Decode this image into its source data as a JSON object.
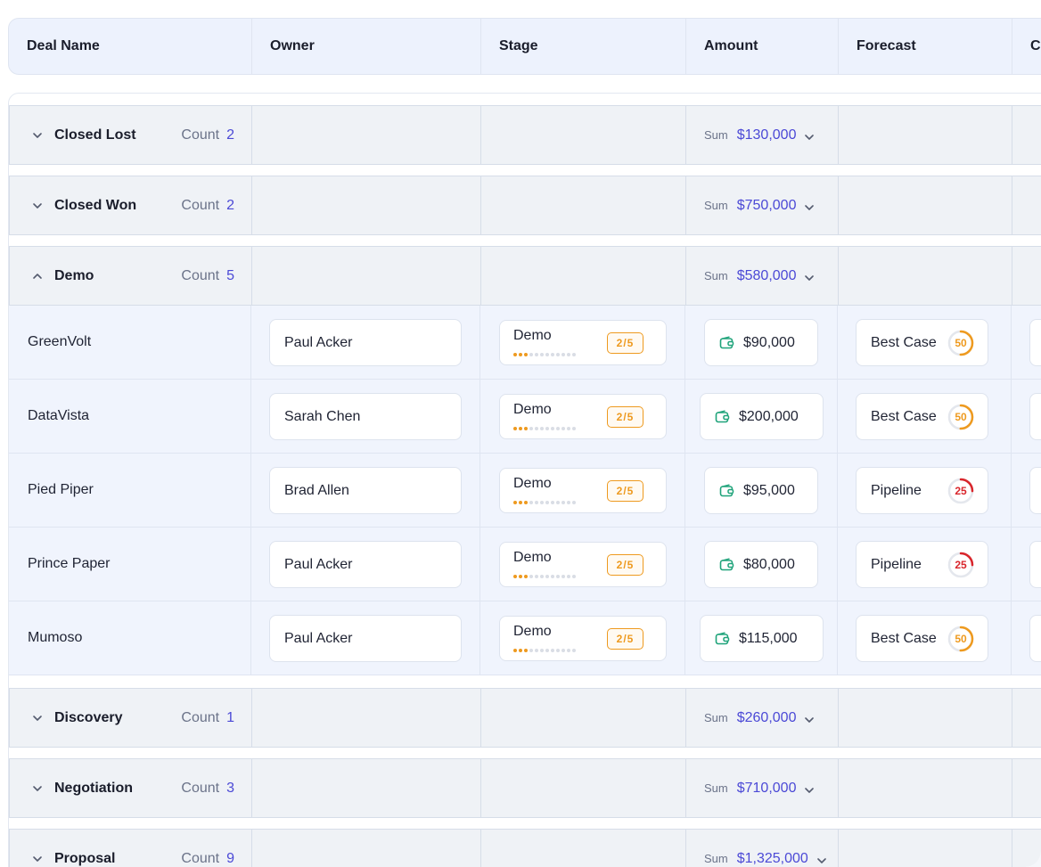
{
  "columns": [
    "Deal Name",
    "Owner",
    "Stage",
    "Amount",
    "Forecast",
    "Cl"
  ],
  "count_label": "Count",
  "sum_label": "Sum",
  "groups": [
    {
      "name": "Closed Lost",
      "count": "2",
      "sum": "$130,000",
      "expanded": false
    },
    {
      "name": "Closed Won",
      "count": "2",
      "sum": "$750,000",
      "expanded": false
    },
    {
      "name": "Demo",
      "count": "5",
      "sum": "$580,000",
      "expanded": true
    },
    {
      "name": "Discovery",
      "count": "1",
      "sum": "$260,000",
      "expanded": false
    },
    {
      "name": "Negotiation",
      "count": "3",
      "sum": "$710,000",
      "expanded": false
    },
    {
      "name": "Proposal",
      "count": "9",
      "sum": "$1,325,000",
      "expanded": false
    }
  ],
  "deals": [
    {
      "name": "GreenVolt",
      "owner": "Paul Acker",
      "stage": "Demo",
      "stage_progress": "2/5",
      "amount": "$90,000",
      "forecast": "Best Case",
      "probability": "50"
    },
    {
      "name": "DataVista",
      "owner": "Sarah Chen",
      "stage": "Demo",
      "stage_progress": "2/5",
      "amount": "$200,000",
      "forecast": "Best Case",
      "probability": "50"
    },
    {
      "name": "Pied Piper",
      "owner": "Brad Allen",
      "stage": "Demo",
      "stage_progress": "2/5",
      "amount": "$95,000",
      "forecast": "Pipeline",
      "probability": "25"
    },
    {
      "name": "Prince Paper",
      "owner": "Paul Acker",
      "stage": "Demo",
      "stage_progress": "2/5",
      "amount": "$80,000",
      "forecast": "Pipeline",
      "probability": "25"
    },
    {
      "name": "Mumoso",
      "owner": "Paul Acker",
      "stage": "Demo",
      "stage_progress": "2/5",
      "amount": "$115,000",
      "forecast": "Best Case",
      "probability": "50"
    }
  ],
  "colors": {
    "accent": "#4b49d6",
    "stage": "#ee9a1f",
    "best_case": "#ee9a1f",
    "pipeline": "#d9262c",
    "wallet": "#1fa37a"
  }
}
